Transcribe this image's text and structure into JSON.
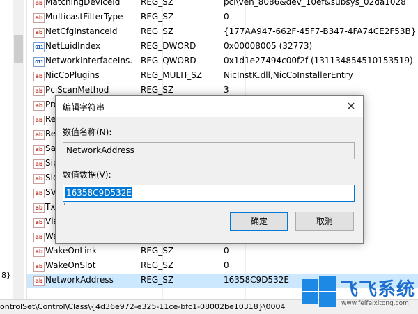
{
  "tree": {
    "path_fragment": "8}"
  },
  "rows": [
    {
      "name": "MatchingDeviceId",
      "type": "REG_SZ",
      "data": "pci\\ven_8086&dev_10ef&subsys_02da1028",
      "icon": "string-value-icon"
    },
    {
      "name": "MulticastFilterType",
      "type": "REG_SZ",
      "data": "0",
      "icon": "string-value-icon"
    },
    {
      "name": "NetCfgInstanceId",
      "type": "REG_SZ",
      "data": "{177AA947-662F-45F7-B347-4FA74CE2F53B}",
      "icon": "string-value-icon"
    },
    {
      "name": "NetLuidIndex",
      "type": "REG_DWORD",
      "data": "0x00008005 (32773)",
      "icon": "binary-value-icon"
    },
    {
      "name": "NetworkInterfaceIns...",
      "type": "REG_QWORD",
      "data": "0x1d1e27494c00f2f (131134854510153519)",
      "icon": "binary-value-icon"
    },
    {
      "name": "NicCoPlugins",
      "type": "REG_MULTI_SZ",
      "data": "NicInstK.dll,NicCoInstallerEntry",
      "icon": "string-value-icon"
    },
    {
      "name": "PciScanMethod",
      "type": "REG_SZ",
      "data": "3",
      "icon": "string-value-icon"
    },
    {
      "name": "Pro",
      "type": "",
      "data": "",
      "icon": "string-value-icon"
    },
    {
      "name": "Re",
      "type": "",
      "data": "",
      "icon": "string-value-icon"
    },
    {
      "name": "Re",
      "type": "",
      "data": "",
      "icon": "string-value-icon"
    },
    {
      "name": "Sa",
      "type": "",
      "data": "",
      "icon": "string-value-icon"
    },
    {
      "name": "Sip",
      "type": "",
      "data": "",
      "icon": "string-value-icon"
    },
    {
      "name": "Slo",
      "type": "",
      "data": "",
      "icon": "string-value-icon"
    },
    {
      "name": "SV",
      "type": "",
      "data": "",
      "icon": "string-value-icon"
    },
    {
      "name": "Tx",
      "type": "",
      "data": "",
      "icon": "string-value-icon"
    },
    {
      "name": "Vla",
      "type": "",
      "data": "",
      "icon": "string-value-icon"
    },
    {
      "name": "Wa",
      "type": "",
      "data": "",
      "icon": "string-value-icon"
    },
    {
      "name": "WakeOnLink",
      "type": "REG_SZ",
      "data": "0",
      "icon": "string-value-icon"
    },
    {
      "name": "WakeOnSlot",
      "type": "REG_SZ",
      "data": "0",
      "icon": "string-value-icon"
    },
    {
      "name": "NetworkAddress",
      "type": "REG_SZ",
      "data": "16358C9D532E",
      "icon": "string-value-icon",
      "selected": true
    }
  ],
  "icon_glyphs": {
    "string": "ab",
    "binary": "011"
  },
  "statusbar": {
    "path": "ontrolSet\\Control\\Class\\{4d36e972-e325-11ce-bfc1-08002be10318}\\0004"
  },
  "dialog": {
    "title": "编辑字符串",
    "close_glyph": "✕",
    "name_label": "数值名称(N):",
    "name_value": "NetworkAddress",
    "data_label": "数值数据(V):",
    "data_value": "16358C9D532E",
    "ok_label": "确定",
    "cancel_label": "取消"
  },
  "watermark": {
    "text": "飞飞系统",
    "url": "www.feifeixitong.com",
    "color": "#1e88e5"
  }
}
